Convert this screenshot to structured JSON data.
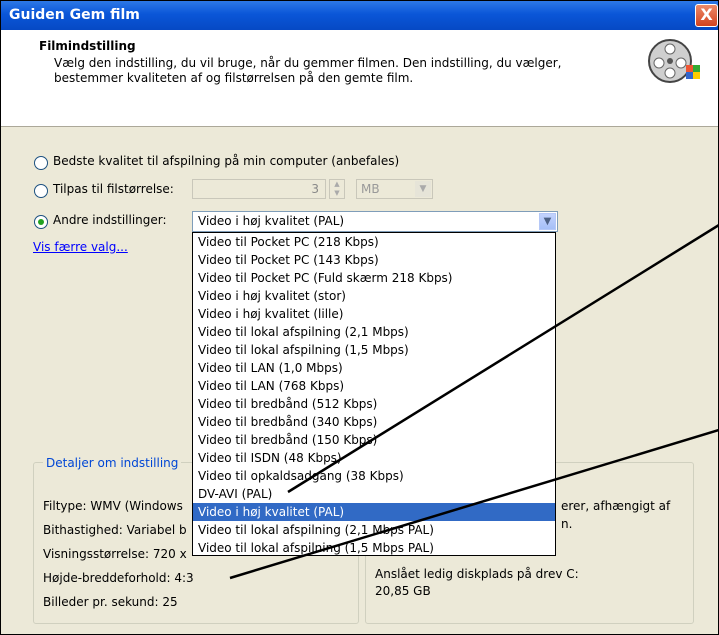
{
  "window": {
    "title": "Guiden Gem film",
    "close": "X"
  },
  "header": {
    "title": "Filmindstilling",
    "description": "Vælg den indstilling, du vil bruge, når du gemmer filmen. Den indstilling, du vælger, bestemmer kvaliteten af og filstørrelsen på den gemte film.",
    "icon": "film-reel-icon"
  },
  "options": {
    "best_quality": "Bedste kvalitet til afspilning på min computer (anbefales)",
    "fit_size": "Tilpas til filstørrelse:",
    "fit_size_value": "3",
    "fit_size_unit": "MB",
    "other": "Andre indstillinger:",
    "selected": "other"
  },
  "preset": {
    "value": "Video i høj kvalitet (PAL)",
    "items": [
      "Video til Pocket PC (218 Kbps)",
      "Video til Pocket PC (143 Kbps)",
      "Video til Pocket PC (Fuld skærm 218 Kbps)",
      "Video i høj kvalitet (stor)",
      "Video i høj kvalitet (lille)",
      "Video til lokal afspilning (2,1 Mbps)",
      "Video til lokal afspilning (1,5 Mbps)",
      "Video til LAN (1,0 Mbps)",
      "Video til LAN (768 Kbps)",
      "Video til bredbånd (512 Kbps)",
      "Video til bredbånd (340 Kbps)",
      "Video til bredbånd (150 Kbps)",
      "Video til ISDN (48 Kbps)",
      "Video til opkaldsadgang (38 Kbps)",
      "DV-AVI (PAL)",
      "Video i høj kvalitet (PAL)",
      "Video til lokal afspilning (2,1 Mbps PAL)",
      "Video til lokal afspilning (1,5 Mbps PAL)"
    ],
    "highlighted_index": 15
  },
  "fewer_link": "Vis færre valg...",
  "details": {
    "legend": "Detaljer om indstilling",
    "filetype": "Filtype: WMV (Windows",
    "bitrate": "Bithastighed: Variabel b",
    "display_size": "Visningsstørrelse: 720 x",
    "aspect": "Højde-breddeforhold: 4:3",
    "fps": "Billeder pr. sekund: 25"
  },
  "disk": {
    "partial1": "erer, afhængigt af",
    "partial2": "n.",
    "free_label": "Anslået ledig diskplads på drev C:",
    "free_value": "20,85 GB"
  }
}
